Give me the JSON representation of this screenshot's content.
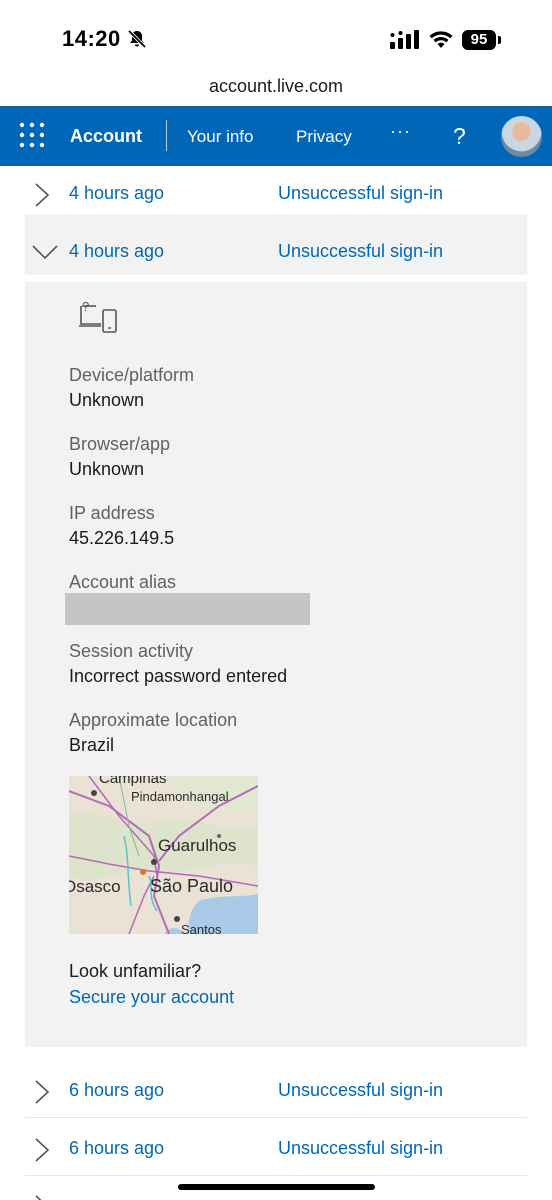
{
  "status_bar": {
    "time": "14:20",
    "battery": "95",
    "icons": [
      "bell-slash-icon",
      "signal-icon",
      "wifi-icon",
      "battery-icon"
    ]
  },
  "browser": {
    "url": "account.live.com"
  },
  "nav": {
    "app_launcher_icon": "waffle-icon",
    "account": "Account",
    "your_info": "Your info",
    "privacy": "Privacy",
    "more": "···",
    "help": "?",
    "brand_color": "#0067b8"
  },
  "activity": [
    {
      "when": "4 hours ago",
      "status": "Unsuccessful sign-in",
      "expanded": false
    },
    {
      "when": "4 hours ago",
      "status": "Unsuccessful sign-in",
      "expanded": true
    },
    {
      "when": "6 hours ago",
      "status": "Unsuccessful sign-in",
      "expanded": false
    },
    {
      "when": "6 hours ago",
      "status": "Unsuccessful sign-in",
      "expanded": false
    }
  ],
  "details": {
    "device_label": "Device/platform",
    "device_value": "Unknown",
    "browser_label": "Browser/app",
    "browser_value": "Unknown",
    "ip_label": "IP address",
    "ip_value": "45.226.149.5",
    "alias_label": "Account alias",
    "session_label": "Session activity",
    "session_value": "Incorrect password entered",
    "location_label": "Approximate location",
    "location_value": "Brazil",
    "map_labels": {
      "campinas": "Campinas",
      "pinda": "Pindamonhangal",
      "guarulhos": "Guarulhos",
      "osasco": "Osasco",
      "saopaulo": "São Paulo",
      "santos": "Santos"
    },
    "unfamiliar": "Look unfamiliar?",
    "secure_link": "Secure your account"
  }
}
